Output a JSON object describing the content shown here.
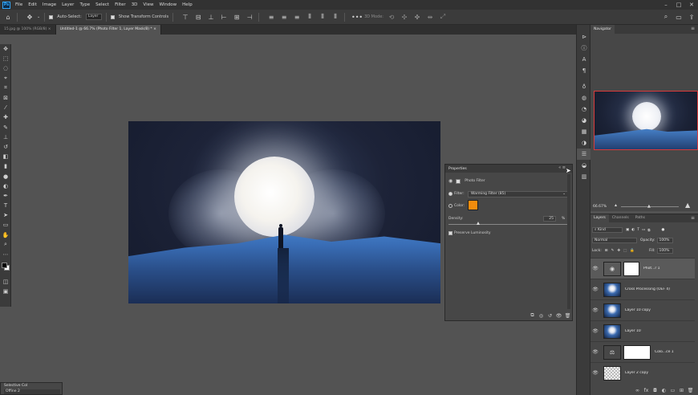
{
  "menubar": {
    "logo": "Ps",
    "items": [
      "File",
      "Edit",
      "Image",
      "Layer",
      "Type",
      "Select",
      "Filter",
      "3D",
      "View",
      "Window",
      "Help"
    ]
  },
  "options": {
    "auto_select_label": "Auto-Select:",
    "auto_select_value": "Layer",
    "show_transform_label": "Show Transform Controls",
    "mode_3d_label": "3D Mode:"
  },
  "tabs": [
    {
      "label": "15.jpg @ 100% (RGB/8) ×"
    },
    {
      "label": "Untitled-1 @ 66.7% (Photo Filter 1, Layer Mask/8) * ×"
    }
  ],
  "properties": {
    "title": "Properties",
    "subtitle": "Photo Filter",
    "filter_label": "Filter:",
    "filter_value": "Warming Filter (85)",
    "color_label": "Color:",
    "color_value": "#f28c0d",
    "density_label": "Density:",
    "density_value": "25",
    "density_unit": "%",
    "density_level": 0.25,
    "preserve_label": "Preserve Luminosity"
  },
  "navigator": {
    "tab": "Navigator",
    "zoom": "66.67%"
  },
  "layers": {
    "tabs": [
      "Layers",
      "Channels",
      "Paths"
    ],
    "kind_label": "Kind",
    "blend_mode": "Normal",
    "opacity_label": "Opacity:",
    "opacity_value": "100%",
    "lock_label": "Lock:",
    "fill_label": "Fill:",
    "fill_value": "100%",
    "items": [
      {
        "name": "Phot...r 1",
        "thumb": "adj",
        "mask": true,
        "selected": true
      },
      {
        "name": "Cross Processing (OEF 4)",
        "thumb": "moon",
        "mask": false,
        "selected": false
      },
      {
        "name": "Layer 10 copy",
        "thumb": "moon",
        "mask": false,
        "selected": false
      },
      {
        "name": "Layer 10",
        "thumb": "moon",
        "mask": false,
        "selected": false
      },
      {
        "name": "Colo...ce 1",
        "thumb": "adj",
        "mask": true,
        "selected": false
      },
      {
        "name": "Layer 2 copy",
        "thumb": "checker",
        "mask": false,
        "selected": false
      }
    ]
  },
  "selective_color": {
    "title": "Selective Col",
    "value": "Offine 2"
  }
}
